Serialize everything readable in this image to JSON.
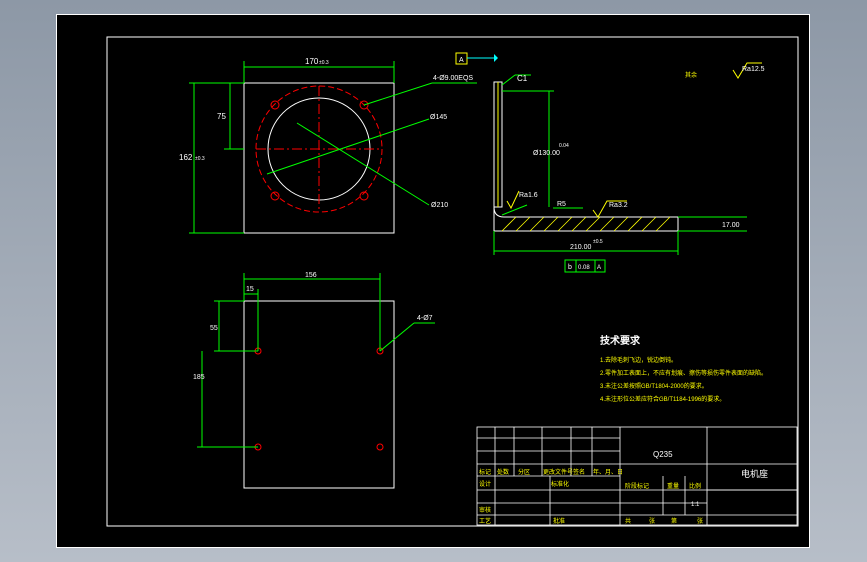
{
  "dimensions": {
    "top_width": "170",
    "top_width_tol": "±0.3",
    "height_75": "75",
    "height_162": "162",
    "height_162_tol": "±0.3",
    "holes_4": "4-Ø9.00EQS",
    "dia_145": "Ø145",
    "dia_210": "Ø210",
    "chamfer": "C1",
    "datum_a": "A",
    "bore_dia": "Ø130.00",
    "bore_tol": "0.04",
    "ra_16": "Ra1.6",
    "ra_32": "Ra3.2",
    "ra_125": "Ra12.5",
    "r5": "R5",
    "thickness": "17.00",
    "length": "210.00",
    "length_tol": "±0.5",
    "ctrl_b": "b",
    "ctrl_val": "0.08",
    "ctrl_datum": "A",
    "bottom_width": "156",
    "bottom_15": "15",
    "bottom_55": "55",
    "bottom_185": "185",
    "holes_bottom": "4-Ø7",
    "rest": "其余"
  },
  "tech": {
    "title": "技术要求",
    "items": [
      "1.去除毛刺飞边，锐边倒钝。",
      "2.零件加工表面上，不应有划痕、擦伤等损伤零件表面的缺陷。",
      "3.未注公差按照GB/T1804-2000的要求。",
      "4.未注形位公差应符合GB/T1184-1996的要求。"
    ]
  },
  "title_block": {
    "material": "Q235",
    "part_name": "电机座",
    "labels": {
      "mark": "标记",
      "count": "处数",
      "zone": "分区",
      "doc_no": "更改文件号",
      "sign": "签名",
      "date": "年、月、日",
      "design": "设计",
      "standard": "标准化",
      "stage": "阶段标记",
      "weight": "重量",
      "scale": "比例",
      "review": "审核",
      "process": "工艺",
      "approve": "批准",
      "total": "共",
      "sheets": "张",
      "num": "第",
      "page": "张"
    },
    "scale_value": "1:1"
  },
  "colors": {
    "background": "#000000",
    "border": "#ffffff",
    "dimension": "#00ff00",
    "outline": "#ffffff",
    "center": "#ff0000",
    "hatch": "#ffff00",
    "text": "#ffff00",
    "leader": "#00ffff"
  }
}
